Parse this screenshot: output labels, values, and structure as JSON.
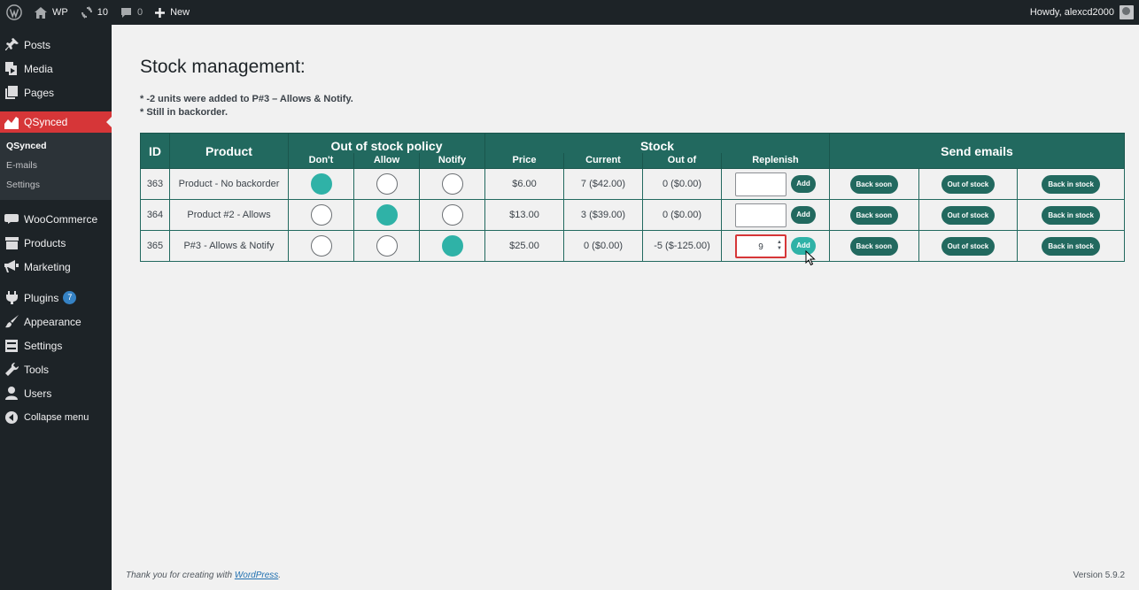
{
  "adminbar": {
    "site_name": "WP",
    "updates_count": "10",
    "comments_count": "0",
    "new_label": "New",
    "howdy": "Howdy, alexcd2000"
  },
  "sidebar": {
    "items": [
      {
        "label": "Posts",
        "icon": "pin-icon"
      },
      {
        "label": "Media",
        "icon": "media-icon"
      },
      {
        "label": "Pages",
        "icon": "pages-icon"
      },
      {
        "label": "QSynced",
        "icon": "chart-icon"
      },
      {
        "label": "WooCommerce",
        "icon": "woo-icon"
      },
      {
        "label": "Products",
        "icon": "archive-icon"
      },
      {
        "label": "Marketing",
        "icon": "megaphone-icon"
      },
      {
        "label": "Plugins",
        "icon": "plugin-icon",
        "badge": "7"
      },
      {
        "label": "Appearance",
        "icon": "brush-icon"
      },
      {
        "label": "Settings",
        "icon": "settings-icon"
      },
      {
        "label": "Tools",
        "icon": "wrench-icon"
      },
      {
        "label": "Users",
        "icon": "user-icon"
      },
      {
        "label": "Collapse menu",
        "icon": "collapse-icon"
      }
    ],
    "submenu": [
      "QSynced",
      "E-mails",
      "Settings"
    ]
  },
  "page": {
    "title": "Stock management:",
    "notices": [
      "* -2 units were added to P#3 – Allows & Notify.",
      "* Still in backorder."
    ]
  },
  "table": {
    "headers": {
      "id": "ID",
      "product": "Product",
      "policy": "Out of stock policy",
      "stock": "Stock",
      "emails": "Send emails",
      "dont": "Don't",
      "allow": "Allow",
      "notify": "Notify",
      "price": "Price",
      "current": "Current",
      "out_of": "Out of",
      "replenish": "Replenish"
    },
    "rows": [
      {
        "id": "363",
        "product": "Product - No backorder",
        "policy": "dont",
        "price": "$6.00",
        "current": "7 ($42.00)",
        "out_of": "0 ($0.00)",
        "qty": ""
      },
      {
        "id": "364",
        "product": "Product #2 - Allows",
        "policy": "allow",
        "price": "$13.00",
        "current": "3 ($39.00)",
        "out_of": "0 ($0.00)",
        "qty": ""
      },
      {
        "id": "365",
        "product": "P#3 - Allows & Notify",
        "policy": "notify",
        "price": "$25.00",
        "current": "0 ($0.00)",
        "out_of": "-5 ($-125.00)",
        "qty": "9"
      }
    ],
    "add_label": "Add",
    "email_buttons": [
      "Back soon",
      "Out of stock",
      "Back in stock"
    ]
  },
  "footer": {
    "thanks_prefix": "Thank you for creating with ",
    "thanks_link": "WordPress",
    "thanks_suffix": ".",
    "version": "Version 5.9.2"
  },
  "colors": {
    "table_header": "#22695f",
    "accent": "#2fb2a7",
    "current_menu": "#d63638"
  }
}
